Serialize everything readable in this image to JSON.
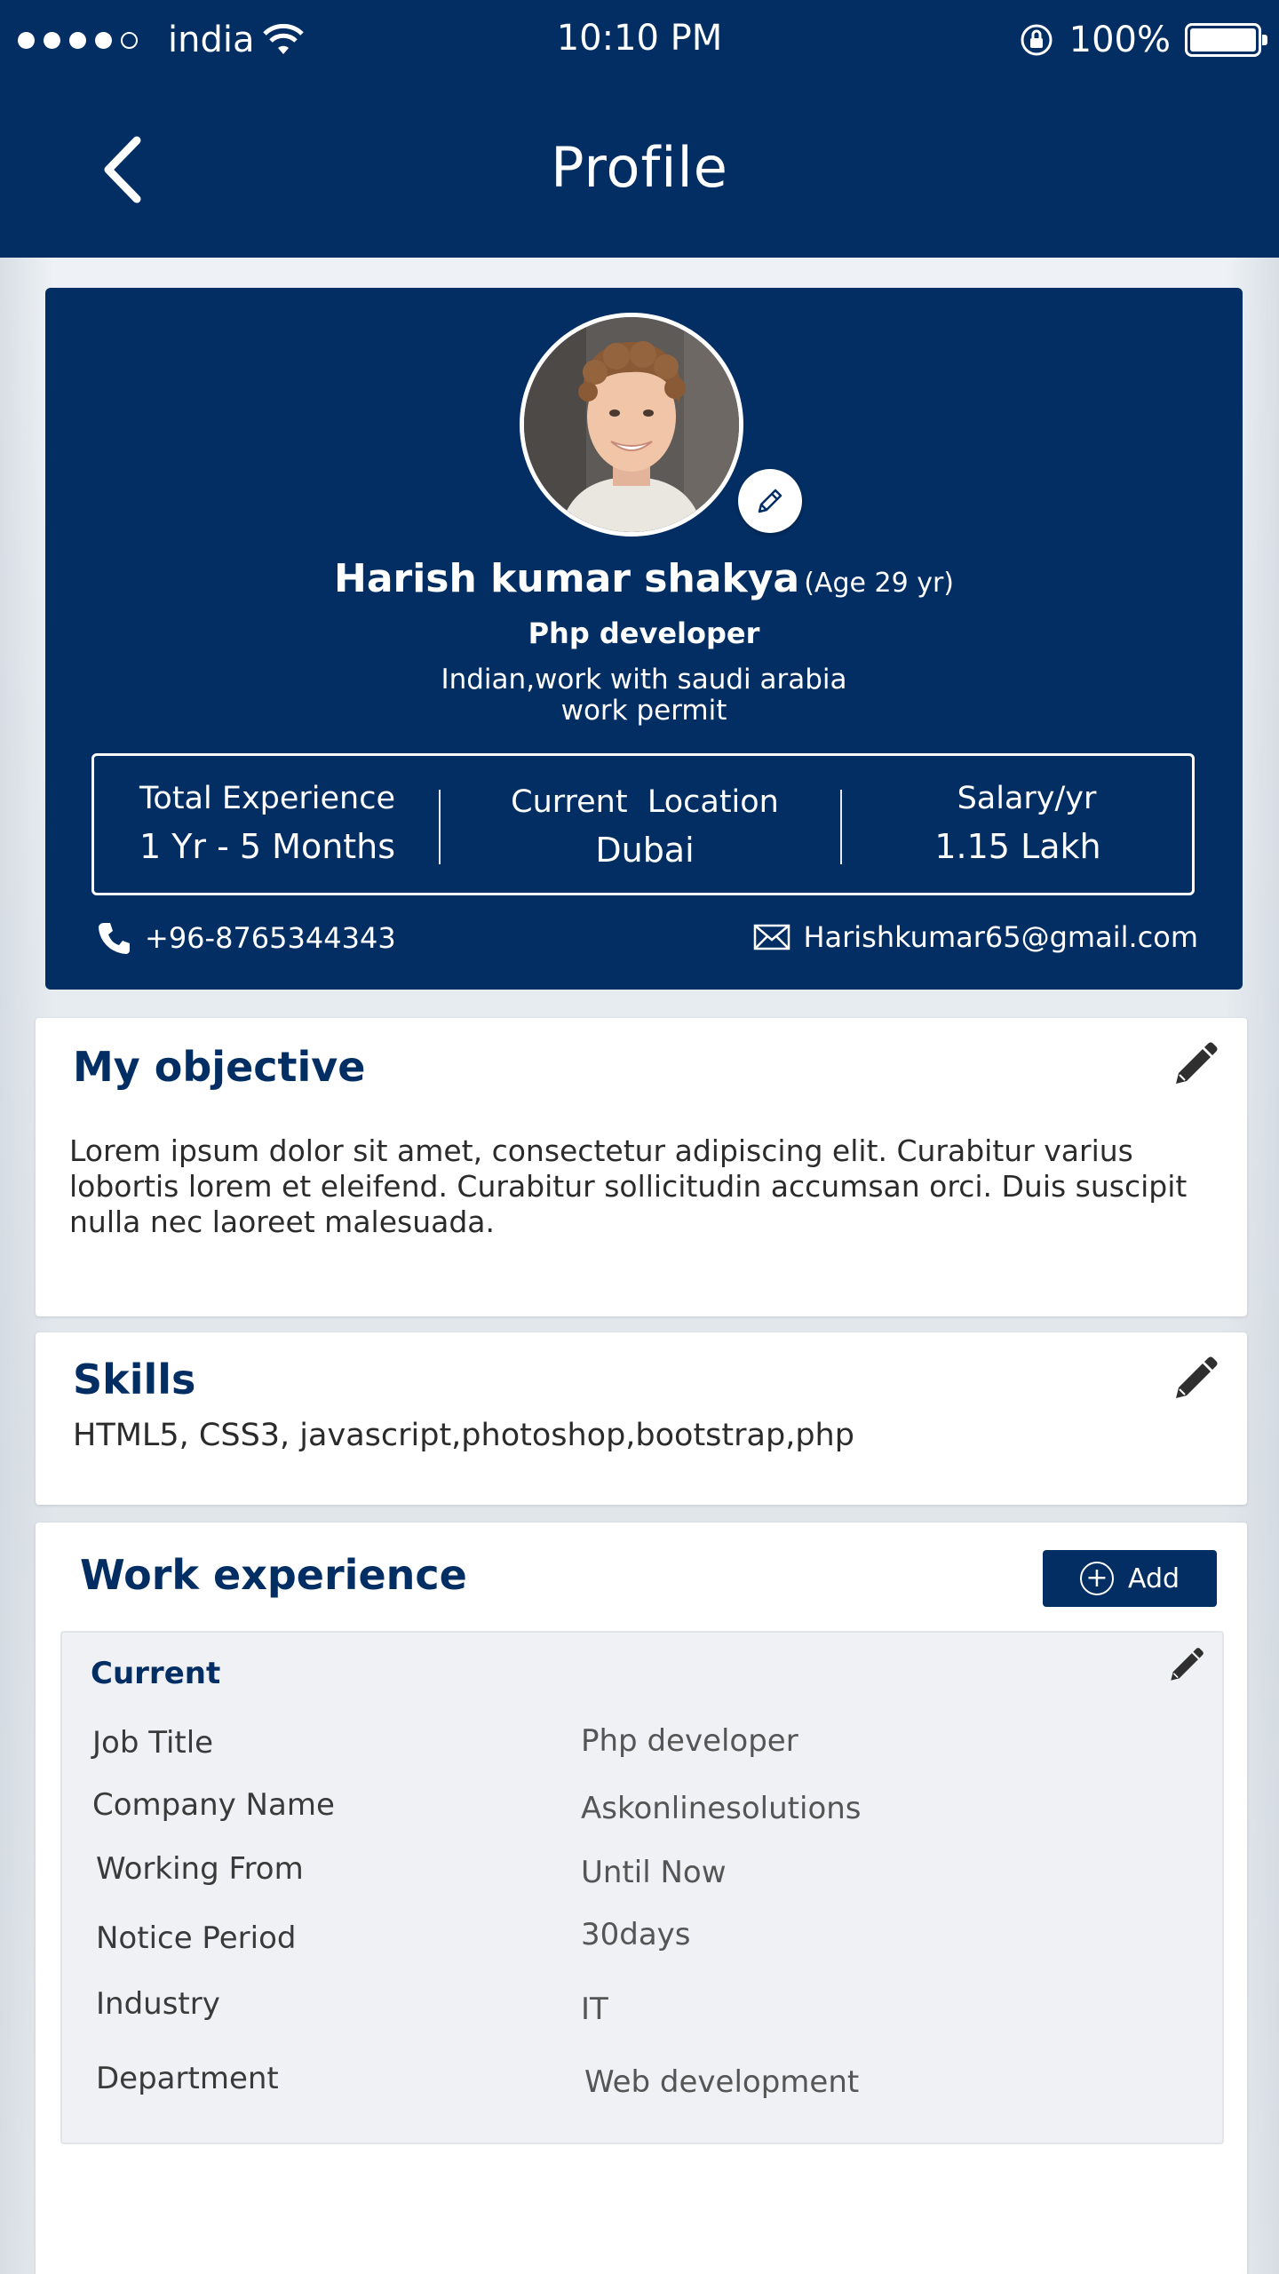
{
  "status_bar": {
    "carrier": "india",
    "time": "10:10 PM",
    "battery": "100%"
  },
  "header": {
    "title": "Profile"
  },
  "profile": {
    "name": "Harish kumar shakya",
    "age": "(Age 29 yr)",
    "role": "Php developer",
    "permit_line1": "Indian,work with saudi arabia",
    "permit_line2": "work permit",
    "stats": [
      {
        "label": "Total Experience",
        "value": "1 Yr - 5 Months"
      },
      {
        "label": "Current  Location",
        "value": "Dubai"
      },
      {
        "label": "Salary/yr",
        "value": "1.15 Lakh"
      }
    ],
    "phone": "+96-8765344343",
    "email": "Harishkumar65@gmail.com"
  },
  "objective": {
    "title": "My objective",
    "text": "Lorem ipsum dolor sit amet, consectetur adipiscing elit. Curabitur varius lobortis lorem et eleifend. Curabitur sollicitudin accumsan orci. Duis suscipit nulla nec laoreet malesuada."
  },
  "skills": {
    "title": "Skills",
    "text": "HTML5, CSS3, javascript,photoshop,bootstrap,php"
  },
  "work": {
    "title": "Work experience",
    "add_label": "Add",
    "current_title": "Current",
    "details": [
      {
        "label": "Job Title",
        "value": "Php developer"
      },
      {
        "label": "Company Name",
        "value": "Askonlinesolutions"
      },
      {
        "label": "Working From",
        "value": "Until Now"
      },
      {
        "label": "Notice Period",
        "value": "30days"
      },
      {
        "label": "Industry",
        "value": "IT"
      },
      {
        "label": "Department",
        "value": "Web development"
      }
    ]
  }
}
